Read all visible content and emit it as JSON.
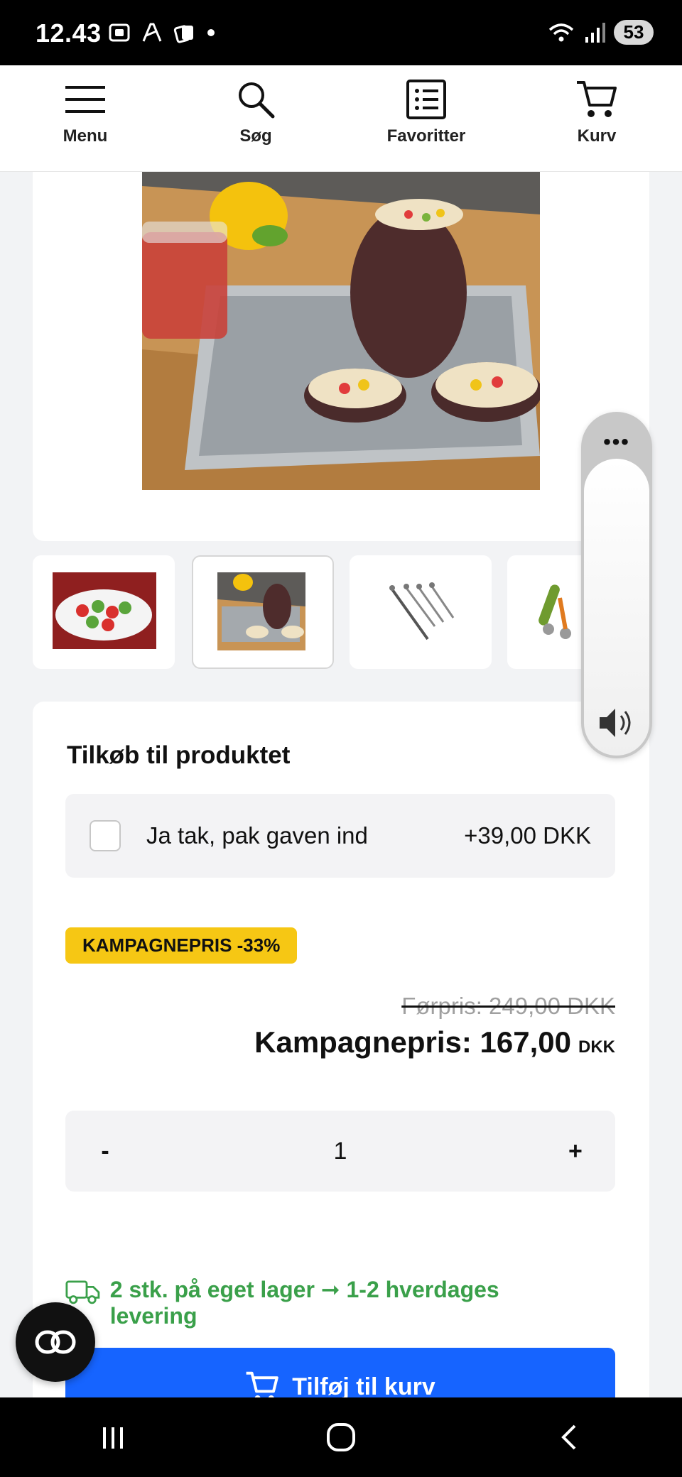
{
  "status_bar": {
    "time": "12.43",
    "battery": "53"
  },
  "nav": {
    "items": [
      {
        "label": "Menu",
        "icon": "menu-icon"
      },
      {
        "label": "Søg",
        "icon": "search-icon"
      },
      {
        "label": "Favoritter",
        "icon": "list-icon"
      },
      {
        "label": "Kurv",
        "icon": "cart-icon"
      }
    ]
  },
  "product": {
    "addon_title": "Tilkøb til produktet",
    "addon": {
      "label": "Ja tak, pak gaven ind",
      "price": "+39,00 DKK",
      "checked": false
    },
    "badge": "KAMPAGNEPRIS -33%",
    "old_price": "Førpris: 249,00 DKK",
    "new_price": "Kampagnepris: 167,00",
    "currency": "DKK",
    "quantity": {
      "minus": "-",
      "value": "1",
      "plus": "+"
    },
    "stock_text": "2 stk. på eget lager ➞ 1-2 hverdages levering",
    "add_to_cart": "Tilføj til kurv"
  },
  "colors": {
    "accent": "#1664ff",
    "badge": "#f6c714",
    "stock": "#3aa04a"
  }
}
